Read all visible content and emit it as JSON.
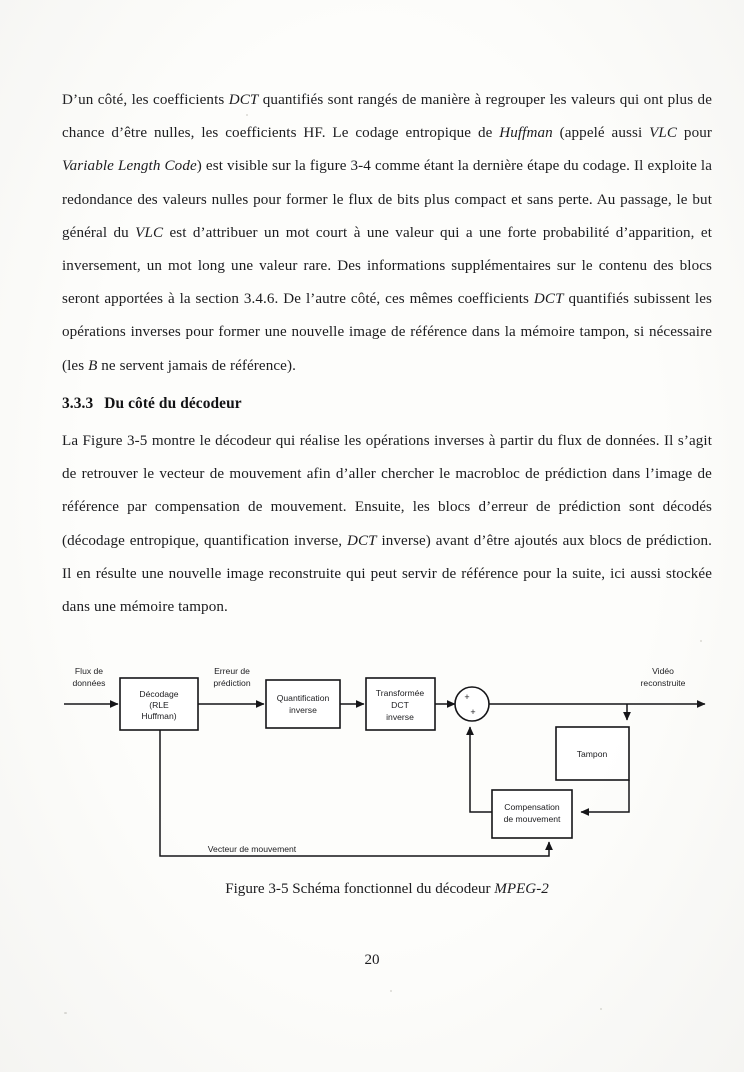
{
  "document": {
    "page_number": "20"
  },
  "paragraph_1": {
    "segments": [
      {
        "text": "D’un côté, les coefficients "
      },
      {
        "text": "DCT",
        "italic": true
      },
      {
        "text": " quantifiés sont rangés de manière à regrouper les valeurs qui ont plus de chance d’être nulles, les coefficients HF. Le codage entropique de "
      },
      {
        "text": "Huffman",
        "italic": true
      },
      {
        "text": " (appelé aussi "
      },
      {
        "text": "VLC",
        "italic": true
      },
      {
        "text": " pour "
      },
      {
        "text": "Variable Length Code",
        "italic": true
      },
      {
        "text": ") est visible sur la figure 3-4 comme étant la dernière étape du codage. Il exploite la redondance des valeurs nulles pour former le flux de bits plus compact et sans perte. Au passage, le but général du "
      },
      {
        "text": "VLC",
        "italic": true
      },
      {
        "text": " est d’attribuer un mot court à une valeur qui a une forte probabilité d’apparition, et inversement, un mot long une valeur rare. Des informations supplémentaires sur le contenu des blocs seront apportées à la section 3.4.6. De l’autre côté, ces mêmes coefficients "
      },
      {
        "text": "DCT",
        "italic": true
      },
      {
        "text": " quantifiés subissent les opérations inverses pour former une nouvelle image de référence dans la mémoire tampon, si nécessaire (les "
      },
      {
        "text": "B",
        "italic": true
      },
      {
        "text": " ne servent jamais de référence)."
      }
    ]
  },
  "heading": {
    "number": "3.3.3",
    "title": "Du côté du décodeur"
  },
  "paragraph_2": {
    "segments": [
      {
        "text": "La Figure 3-5 montre le décodeur qui réalise les opérations inverses à partir du flux de données. Il s’agit de retrouver le vecteur de mouvement afin d’aller chercher le macrobloc de prédiction dans l’image de référence par compensation de mouvement. Ensuite, les blocs d’erreur de prédiction sont décodés (décodage entropique, quantification inverse, "
      },
      {
        "text": "DCT",
        "italic": true
      },
      {
        "text": " inverse) avant d’être ajoutés aux blocs de prédiction. Il en résulte une nouvelle image reconstruite qui peut servir de référence pour la suite, ici aussi stockée dans une mémoire tampon."
      }
    ]
  },
  "figure": {
    "caption_prefix": "Figure 3-5 Schéma fonctionnel du décodeur ",
    "caption_italic": "MPEG-2",
    "blocks": {
      "decodage_line1": "Décodage",
      "decodage_line2": "(RLE",
      "decodage_line3": "Huffman)",
      "quantification_line1": "Quantification",
      "quantification_line2": "inverse",
      "transformee_line1": "Transformée",
      "transformee_line2": "DCT",
      "transformee_line3": "inverse",
      "tampon": "Tampon",
      "compensation_line1": "Compensation",
      "compensation_line2": "de mouvement"
    },
    "signal_labels": {
      "input_line1": "Flux de",
      "input_line2": "données",
      "erreur_line1": "Erreur de",
      "erreur_line2": "prédiction",
      "output_line1": "Vidéo",
      "output_line2": "reconstruite",
      "vecteur": "Vecteur de mouvement"
    },
    "adder_signs": {
      "top": "+",
      "bottom": "+"
    }
  }
}
